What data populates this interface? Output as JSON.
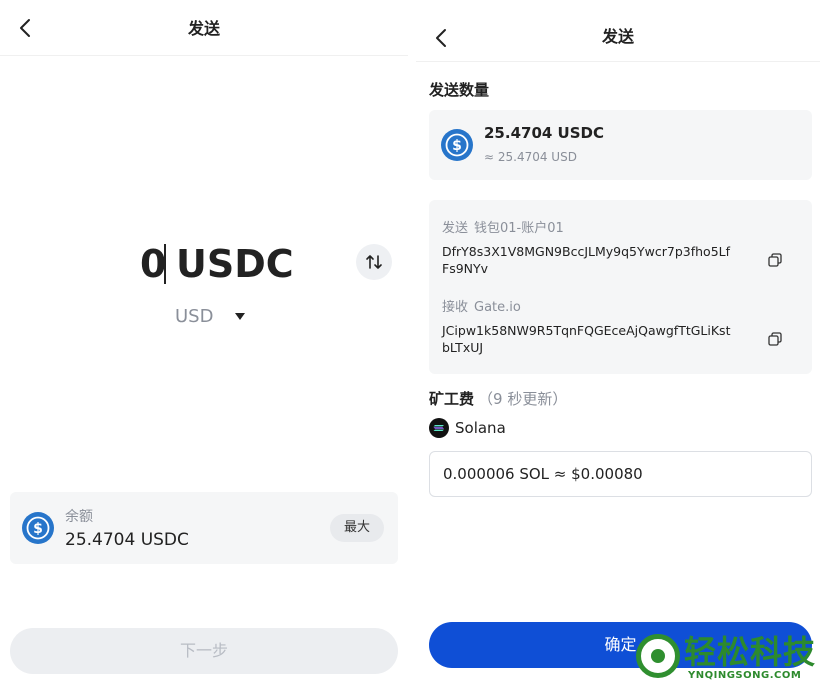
{
  "left": {
    "header": {
      "title": "发送"
    },
    "amount": {
      "value": "0",
      "unit": "USDC"
    },
    "currency": {
      "selected": "USD"
    },
    "balance": {
      "label": "余额",
      "value": "25.4704 USDC",
      "max_label": "最大"
    },
    "next_label": "下一步"
  },
  "right": {
    "header": {
      "title": "发送"
    },
    "send_amount": {
      "section_title": "发送数量",
      "amount": "25.4704 USDC",
      "fiat": "≈ 25.4704 USD"
    },
    "from": {
      "label": "发送",
      "name": "钱包01-账户01",
      "address": "DfrY8s3X1V8MGN9BccJLMy9q5Ywcr7p3fho5LfFs9NYv"
    },
    "to": {
      "label": "接收",
      "name": "Gate.io",
      "address": "JCipw1k58NW9R5TqnFQGEceAjQawgfTtGLiKstbLTxUJ"
    },
    "fee": {
      "title": "矿工费",
      "hint": "（9 秒更新）",
      "network": "Solana",
      "value": "0.000006 SOL ≈ $0.00080"
    },
    "confirm_label": "确定"
  },
  "watermark": {
    "text": "轻松科技",
    "sub": "YNQINGSONG.COM"
  },
  "colors": {
    "accent": "#0f4fd6",
    "usdc": "#2775ca",
    "muted": "#8a8f99",
    "card": "#f5f6f7"
  },
  "icons": [
    "back-icon",
    "swap-icon",
    "usdc-icon",
    "copy-icon",
    "solana-icon",
    "dropdown-icon"
  ]
}
